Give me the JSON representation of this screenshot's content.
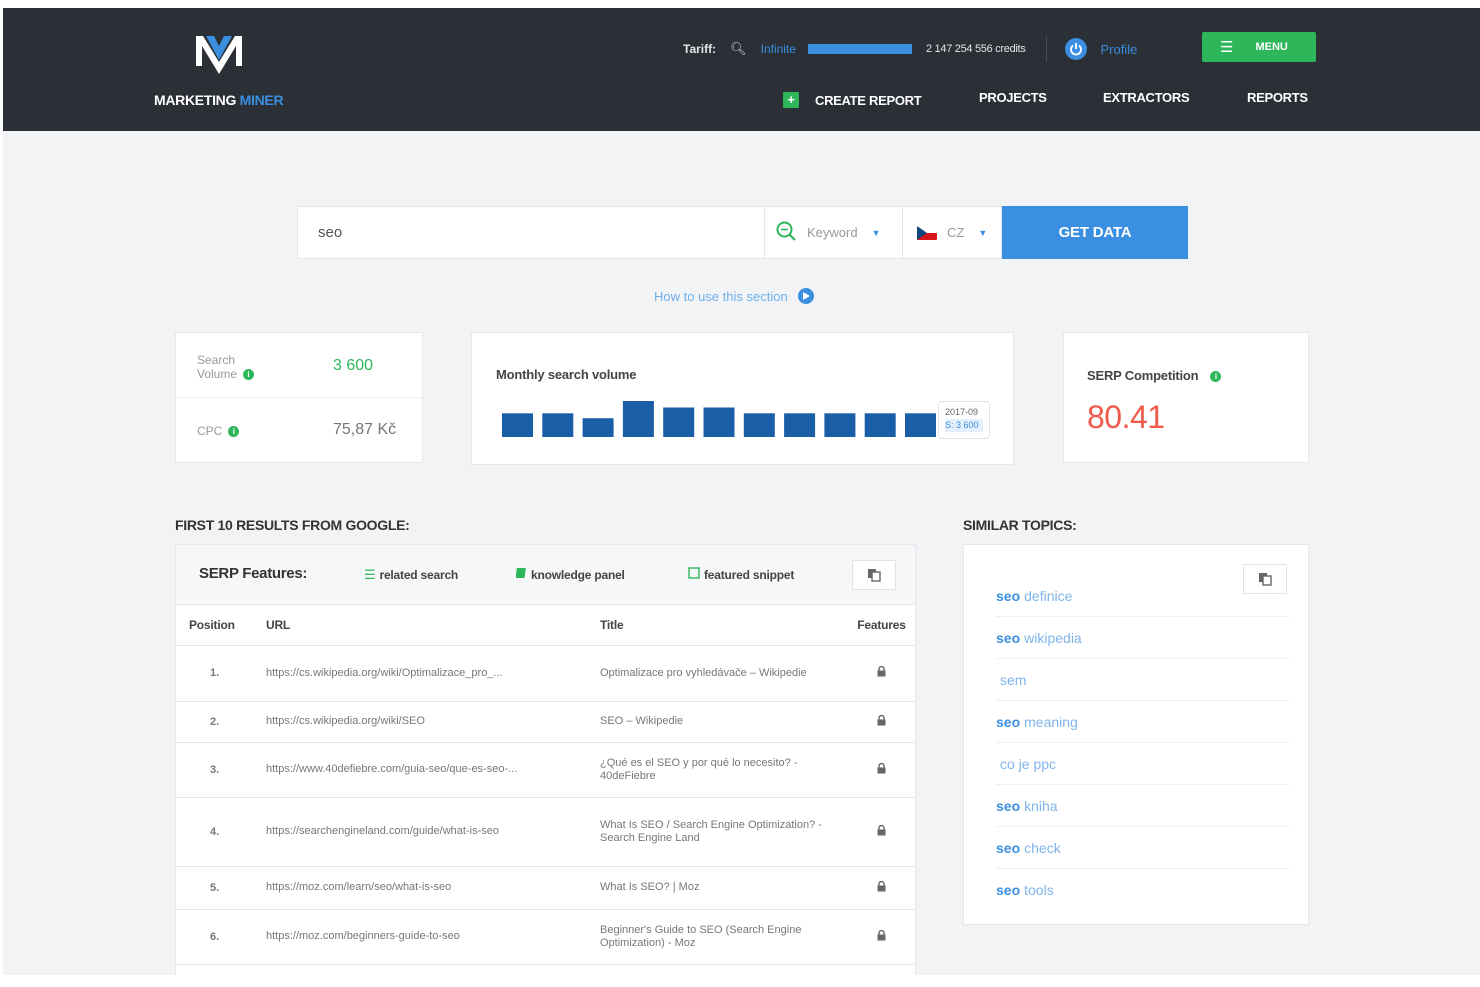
{
  "header": {
    "logo_main": "MARKETING",
    "logo_accent": "MINER",
    "tariff_label": "Tariff:",
    "tariff_value": "Infinite",
    "credits": "2 147 254 556 credits",
    "profile_label": "Profile",
    "menu_label": "MENU",
    "nav": {
      "create_report": "CREATE REPORT",
      "projects": "PROJECTS",
      "extractors": "EXTRACTORS",
      "reports": "REPORTS"
    }
  },
  "search": {
    "query": "seo",
    "type": "Keyword",
    "country": "CZ",
    "button": "GET DATA",
    "howto": "How to use this section"
  },
  "metrics": {
    "search_volume_label_1": "Search",
    "search_volume_label_2": "Volume",
    "search_volume_value": "3 600",
    "cpc_label": "CPC",
    "cpc_value": "75,87 Kč"
  },
  "monthly": {
    "title": "Monthly search volume",
    "tooltip_date": "2017-09",
    "tooltip_value": "S: 3 600"
  },
  "chart_data": {
    "type": "bar",
    "title": "Monthly search volume",
    "categories": [
      "",
      "",
      "",
      "",
      "",
      "",
      "",
      "",
      "",
      "",
      ""
    ],
    "values": [
      2900,
      2900,
      2300,
      4400,
      3600,
      3600,
      2900,
      2900,
      2900,
      2900,
      2900
    ],
    "ylim": [
      0,
      4400
    ]
  },
  "serp_competition": {
    "label": "SERP Competition",
    "value": "80.41"
  },
  "results": {
    "section_title": "FIRST 10 RESULTS FROM GOOGLE:",
    "features_label": "SERP Features:",
    "features": [
      "related search",
      "knowledge panel",
      "featured snippet"
    ],
    "columns": [
      "Position",
      "URL",
      "Title",
      "Features"
    ],
    "rows": [
      {
        "pos": "1.",
        "url": "https://cs.wikipedia.org/wiki/Optimalizace_pro_...",
        "title": "Optimalizace pro vyhledávače – Wikipedie"
      },
      {
        "pos": "2.",
        "url": "https://cs.wikipedia.org/wiki/SEO",
        "title": "SEO – Wikipedie"
      },
      {
        "pos": "3.",
        "url": "https://www.40defiebre.com/guia-seo/que-es-seo-...",
        "title": "¿Qué es el SEO y por qué lo necesito? - 40deFiebre"
      },
      {
        "pos": "4.",
        "url": "https://searchengineland.com/guide/what-is-seo",
        "title": "What Is SEO / Search Engine Optimization? - Search Engine Land"
      },
      {
        "pos": "5.",
        "url": "https://moz.com/learn/seo/what-is-seo",
        "title": "What Is SEO? | Moz"
      },
      {
        "pos": "6.",
        "url": "https://moz.com/beginners-guide-to-seo",
        "title": "Beginner's Guide to SEO (Search Engine Optimization) - Moz"
      }
    ]
  },
  "similar": {
    "section_title": "SIMILAR TOPICS:",
    "topics": [
      {
        "bold": "seo",
        "rest": "definice"
      },
      {
        "bold": "seo",
        "rest": "wikipedia"
      },
      {
        "bold": "",
        "rest": "sem"
      },
      {
        "bold": "seo",
        "rest": "meaning"
      },
      {
        "bold": "",
        "rest": "co je ppc"
      },
      {
        "bold": "seo",
        "rest": "kniha"
      },
      {
        "bold": "seo",
        "rest": "check"
      },
      {
        "bold": "seo",
        "rest": "tools"
      }
    ]
  },
  "colors": {
    "header_bg": "#2b2f36",
    "accent_blue": "#3b8fe0",
    "bar_blue": "#1a5ea8",
    "green": "#2eb65b",
    "competition_red": "#ef5a4b"
  }
}
